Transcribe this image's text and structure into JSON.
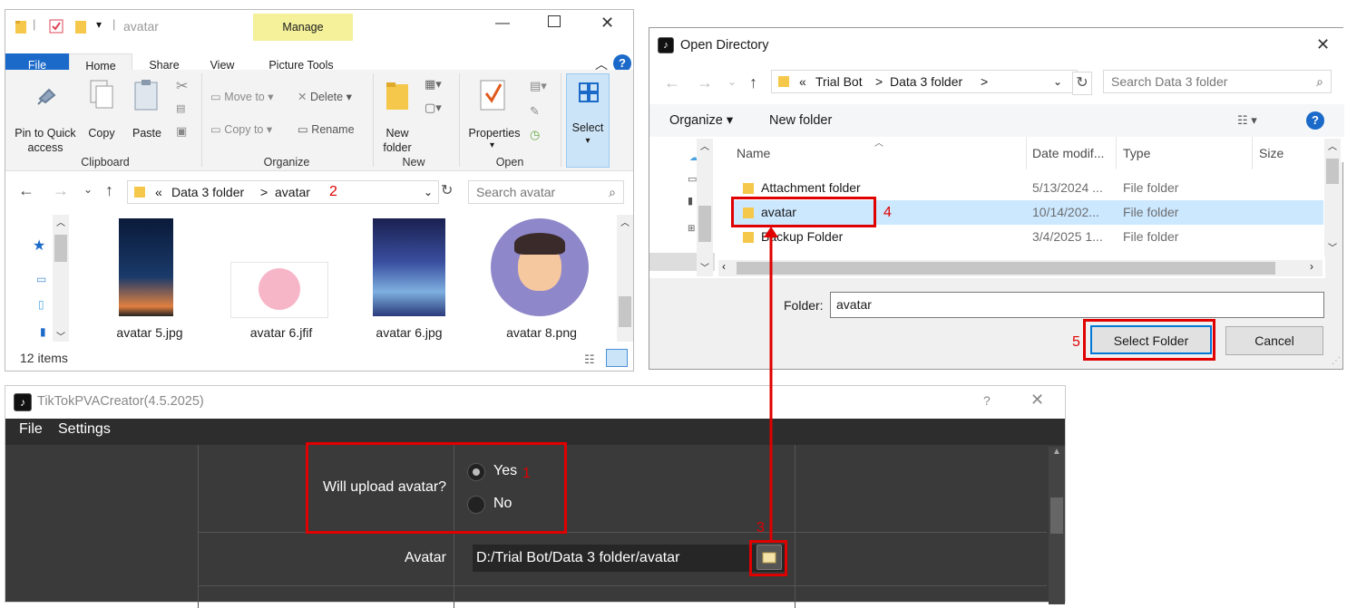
{
  "explorer": {
    "title": "avatar",
    "manage_label": "Manage",
    "tabs": [
      "File",
      "Home",
      "Share",
      "View",
      "Picture Tools"
    ],
    "clipboard": {
      "pin": "Pin to Quick access",
      "pin1": "Pin to Quick",
      "pin2": "access",
      "copy": "Copy",
      "paste": "Paste",
      "label": "Clipboard"
    },
    "organize": {
      "move_to": "Move to",
      "copy_to": "Copy to",
      "delete": "Delete",
      "rename": "Rename",
      "label": "Organize"
    },
    "new": {
      "new_folder1": "New",
      "new_folder2": "folder",
      "label": "New"
    },
    "open": {
      "properties": "Properties",
      "label": "Open"
    },
    "select": {
      "label": "Select"
    },
    "breadcrumb": {
      "chev": "«",
      "folder": "Data 3 folder",
      "sep": ">",
      "current": "avatar"
    },
    "search_placeholder": "Search avatar",
    "files": [
      "avatar 5.jpg",
      "avatar 6.jfif",
      "avatar 6.jpg",
      "avatar 8.png"
    ],
    "status": "12 items"
  },
  "dialog": {
    "title": "Open Directory",
    "breadcrumb": {
      "chev": "«",
      "root": "Trial Bot",
      "sep": ">",
      "folder": "Data 3 folder",
      "sep2": ">"
    },
    "search_placeholder": "Search Data 3 folder",
    "organize": "Organize",
    "new_folder": "New folder",
    "columns": {
      "name": "Name",
      "date": "Date modif...",
      "type": "Type",
      "size": "Size"
    },
    "rows": [
      {
        "name": "Attachment folder",
        "date": "5/13/2024 ...",
        "type": "File folder"
      },
      {
        "name": "avatar",
        "date": "10/14/202...",
        "type": "File folder"
      },
      {
        "name": "Backup Folder",
        "date": "3/4/2025 1...",
        "type": "File folder"
      }
    ],
    "folder_label": "Folder:",
    "folder_value": "avatar",
    "select_button": "Select Folder",
    "cancel_button": "Cancel"
  },
  "app": {
    "title": "TikTokPVACreator(4.5.2025)",
    "help": "?",
    "menu": [
      "File",
      "Settings"
    ],
    "upload_question": "Will upload avatar?",
    "yes": "Yes",
    "no": "No",
    "avatar_label": "Avatar",
    "avatar_path": "D:/Trial Bot/Data 3 folder/avatar"
  },
  "annotations": [
    "1",
    "2",
    "3",
    "4",
    "5"
  ],
  "colors": {
    "accent": "#1b6ac9",
    "annotation": "#e00000",
    "selected_row": "#cce8ff",
    "manage": "#f4f19a"
  }
}
